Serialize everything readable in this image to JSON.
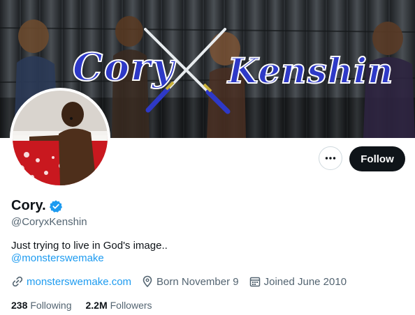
{
  "banner": {
    "title_left": "Cory",
    "title_right": "Kenshin",
    "accent_color": "#2e39c7"
  },
  "profile": {
    "display_name": "Cory.",
    "handle": "@CoryxKenshin",
    "bio": "Just trying to live in God's image..",
    "bio_mention": "@monsterswemake",
    "website": "monsterswemake.com",
    "birthday": "Born November 9",
    "joined": "Joined June 2010",
    "following_count": "238",
    "following_label": "Following",
    "followers_count": "2.2M",
    "followers_label": "Followers"
  },
  "actions": {
    "more_icon": "more-horizontal-icon",
    "follow_label": "Follow"
  },
  "colors": {
    "link": "#1d9bf0",
    "verified": "#1d9bf0",
    "button_dark": "#0f1419",
    "secondary_text": "#536471"
  }
}
